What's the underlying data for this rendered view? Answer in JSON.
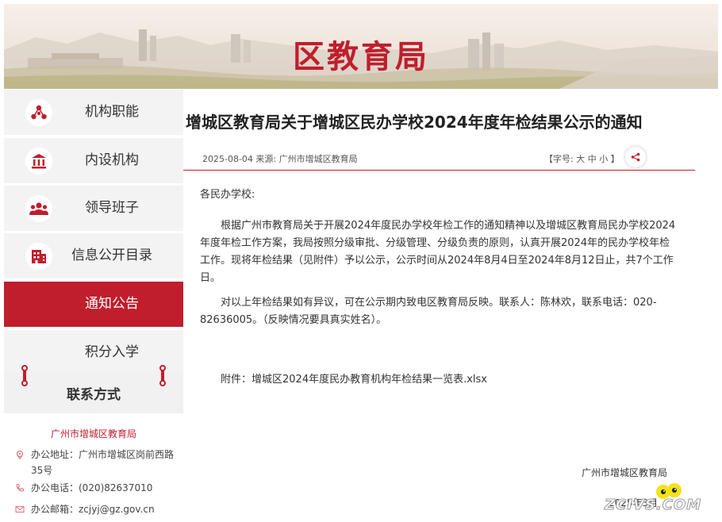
{
  "banner": {
    "title": "区教育局"
  },
  "sidebar": {
    "items": [
      {
        "label": "机构职能",
        "icon": "org-icon",
        "active": false
      },
      {
        "label": "内设机构",
        "icon": "building-icon",
        "active": false
      },
      {
        "label": "领导班子",
        "icon": "people-icon",
        "active": false
      },
      {
        "label": "信息公开目录",
        "icon": "directory-icon",
        "active": false
      },
      {
        "label": "通知公告",
        "icon": "",
        "active": true
      },
      {
        "label": "积分入学",
        "icon": "",
        "active": false
      }
    ],
    "contact": {
      "title": "联系方式",
      "org": "广州市增城区教育局",
      "address": "办公地址：广州市增城区岗前西路35号",
      "phone": "办公电话：(020)82637010",
      "email": "办公邮箱：zcjyj@gz.gov.cn"
    }
  },
  "article": {
    "title": "增城区教育局关于增城区民办学校2024年度年检结果公示的通知",
    "meta": "2025-08-04 来源: 广州市增城区教育局",
    "font_size": {
      "prefix": "【字号:",
      "large": "大",
      "medium": "中",
      "small": "小",
      "suffix": "】"
    },
    "salutation": "各民办学校:",
    "para1": "根据广州市教育局关于开展2024年度民办学校年检工作的通知精神以及增城区教育局民办学校2024年度年检工作方案，我局按照分级审批、分级管理、分级负责的原则，认真开展2024年的民办学校年检工作。现将年检结果（见附件）予以公示，公示时间从2024年8月4日至2024年8月12日止，共7个工作日。",
    "para2": "对以上年检结果如有异议，可在公示期内致电区教育局反映。联系人：陈林欢，联系电话：020-82636005。（反映情况要具真实姓名）。",
    "attachment_prefix": "附件：",
    "attachment_link": "增城区2024年度民办教育机构年检结果一览表.xlsx",
    "signature_org": "广州市增城区教育局",
    "signature_date": "2025年3月"
  },
  "watermark": {
    "text": "ZCIVS.COM"
  },
  "colors": {
    "accent": "#c01e2c",
    "nav_bg": "#f3f3f3"
  }
}
